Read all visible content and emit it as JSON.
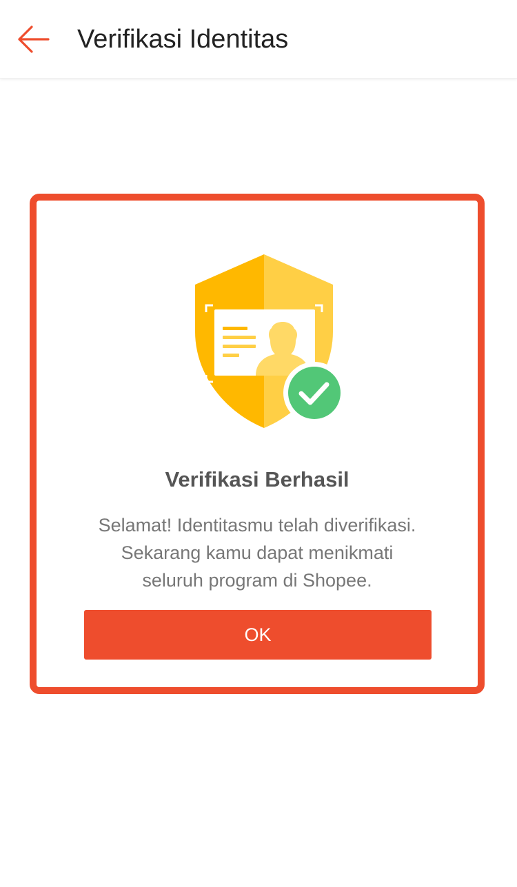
{
  "header": {
    "back_icon": "arrow-left-icon",
    "title": "Verifikasi Identitas"
  },
  "dialog": {
    "illustration_icons": [
      "shield-icon",
      "id-card-icon",
      "check-circle-icon"
    ],
    "title": "Verifikasi Berhasil",
    "message_lines": [
      "Selamat! Identitasmu telah diverifikasi.",
      "Sekarang kamu dapat menikmati",
      "seluruh program di Shopee."
    ],
    "ok_label": "OK"
  },
  "colors": {
    "brand": "#ee4d2d",
    "shield_dark": "#ffb800",
    "shield_light": "#ffcf45",
    "check_green": "#52c777"
  }
}
